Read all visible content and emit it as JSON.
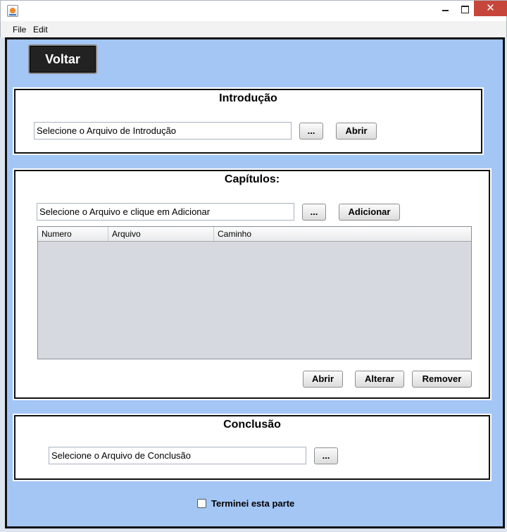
{
  "window": {
    "title": "",
    "icons": {
      "app": "java-cup-icon",
      "minimize": "minimize-icon",
      "maximize": "maximize-icon",
      "close": "close-icon"
    },
    "close_glyph": "✕"
  },
  "menu": {
    "file": "File",
    "edit": "Edit"
  },
  "voltar_label": "Voltar",
  "introducao": {
    "title": "Introdução",
    "field_value": "Selecione o Arquivo de Introdução",
    "browse_label": "...",
    "abrir_label": "Abrir"
  },
  "capitulos": {
    "title": "Capítulos:",
    "field_value": "Selecione o Arquivo e clique em Adicionar",
    "browse_label": "...",
    "adicionar_label": "Adicionar",
    "table": {
      "columns": [
        "Numero",
        "Arquivo",
        "Caminho"
      ],
      "rows": []
    },
    "abrir_label": "Abrir",
    "alterar_label": "Alterar",
    "remover_label": "Remover"
  },
  "conclusao": {
    "title": "Conclusão",
    "field_value": "Selecione o Arquivo de Conclusão",
    "browse_label": "..."
  },
  "done_checkbox": {
    "label": "Terminei esta parte",
    "checked": false
  },
  "colors": {
    "background": "#a3c6f5",
    "close_button": "#c7463b",
    "voltar_button": "#222222",
    "table_body": "#d6d9df"
  }
}
